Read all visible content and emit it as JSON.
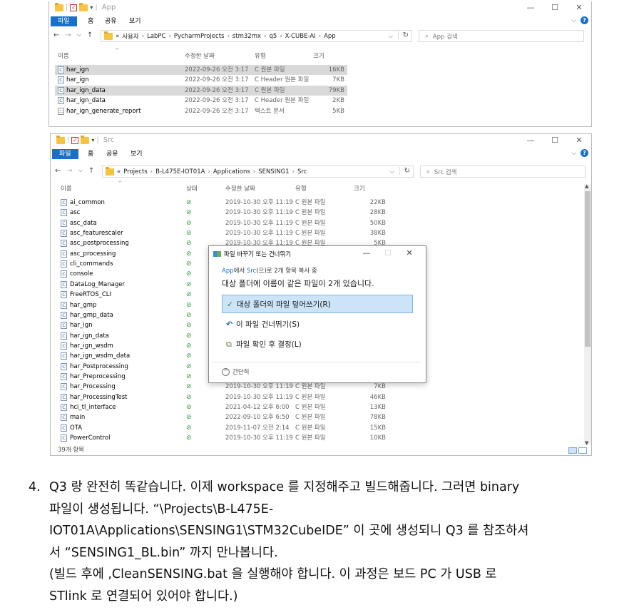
{
  "win1": {
    "title": "App",
    "ribbon": {
      "file": "파일",
      "home": "홈",
      "share": "공유",
      "view": "보기"
    },
    "address": {
      "prefix": "«",
      "parts": [
        "사용자",
        "LabPC",
        "PycharmProjects",
        "stm32mx",
        "q5",
        "X-CUBE-AI",
        "App"
      ]
    },
    "search_placeholder": "App 검색",
    "columns": {
      "name": "이름",
      "date": "수정한 날짜",
      "type": "유형",
      "size": "크기"
    },
    "files": [
      {
        "name": "har_ign",
        "date": "2022-09-26 오전 3:17",
        "type": "C 원본 파일",
        "size": "16KB",
        "icon": "C"
      },
      {
        "name": "har_ign",
        "date": "2022-09-26 오전 3:17",
        "type": "C Header 원본 파일",
        "size": "7KB",
        "icon": "C"
      },
      {
        "name": "har_ign_data",
        "date": "2022-09-26 오전 3:17",
        "type": "C 원본 파일",
        "size": "79KB",
        "icon": "C"
      },
      {
        "name": "har_ign_data",
        "date": "2022-09-26 오전 3:17",
        "type": "C Header 원본 파일",
        "size": "2KB",
        "icon": "C"
      },
      {
        "name": "har_ign_generate_report",
        "date": "2022-09-26 오전 3:17",
        "type": "텍스트 문서",
        "size": "5KB",
        "icon": "txt"
      }
    ]
  },
  "win2": {
    "title": "Src",
    "ribbon": {
      "file": "파일",
      "home": "홈",
      "share": "공유",
      "view": "보기"
    },
    "address": {
      "prefix": "«",
      "parts": [
        "Projects",
        "B-L475E-IOT01A",
        "Applications",
        "SENSING1",
        "Src"
      ]
    },
    "search_placeholder": "Src 검색",
    "columns": {
      "name": "이름",
      "status": "상태",
      "date": "수정한 날짜",
      "type": "유형",
      "size": "크기"
    },
    "files": [
      {
        "name": "ai_common",
        "date": "2019-10-30 오후 11:19",
        "type": "C 원본 파일",
        "size": "22KB"
      },
      {
        "name": "asc",
        "date": "2019-10-30 오후 11:19",
        "type": "C 원본 파일",
        "size": "28KB"
      },
      {
        "name": "asc_data",
        "date": "2019-10-30 오후 11:19",
        "type": "C 원본 파일",
        "size": "50KB"
      },
      {
        "name": "asc_featurescaler",
        "date": "2019-10-30 오후 11:19",
        "type": "C 원본 파일",
        "size": "38KB"
      },
      {
        "name": "asc_postprocessing",
        "date": "2019-10-30 오후 11:19",
        "type": "C 원본 파일",
        "size": "5KB"
      },
      {
        "name": "asc_processing",
        "date": "",
        "type": "",
        "size": ""
      },
      {
        "name": "cli_commands",
        "date": "",
        "type": "",
        "size": ""
      },
      {
        "name": "console",
        "date": "",
        "type": "",
        "size": ""
      },
      {
        "name": "DataLog_Manager",
        "date": "",
        "type": "",
        "size": ""
      },
      {
        "name": "FreeRTOS_CLI",
        "date": "",
        "type": "",
        "size": ""
      },
      {
        "name": "har_gmp",
        "date": "",
        "type": "",
        "size": ""
      },
      {
        "name": "har_gmp_data",
        "date": "",
        "type": "",
        "size": ""
      },
      {
        "name": "har_ign",
        "date": "",
        "type": "",
        "size": ""
      },
      {
        "name": "har_ign_data",
        "date": "",
        "type": "",
        "size": ""
      },
      {
        "name": "har_ign_wsdm",
        "date": "",
        "type": "",
        "size": ""
      },
      {
        "name": "har_ign_wsdm_data",
        "date": "",
        "type": "",
        "size": ""
      },
      {
        "name": "har_Postprocessing",
        "date": "",
        "type": "",
        "size": ""
      },
      {
        "name": "har_Preprocessing",
        "date": "",
        "type": "",
        "size": ""
      },
      {
        "name": "har_Processing",
        "date": "2019-10-30 오후 11:19",
        "type": "C 원본 파일",
        "size": "7KB"
      },
      {
        "name": "har_ProcessingTest",
        "date": "2019-10-30 오후 11:19",
        "type": "C 원본 파일",
        "size": "46KB"
      },
      {
        "name": "hci_tl_interface",
        "date": "2021-04-12 오후 6:00",
        "type": "C 원본 파일",
        "size": "13KB"
      },
      {
        "name": "main",
        "date": "2022-09-10 오후 6:50",
        "type": "C 원본 파일",
        "size": "78KB"
      },
      {
        "name": "OTA",
        "date": "2019-11-07 오전 2:14",
        "type": "C 원본 파일",
        "size": "15KB"
      },
      {
        "name": "PowerControl",
        "date": "2019-10-30 오후 11:19",
        "type": "C 원본 파일",
        "size": "10KB"
      }
    ],
    "status_count": "39개 항목"
  },
  "dialog": {
    "title": "파일 바꾸기 또는 건너뛰기",
    "from_src": "App",
    "from_mid": "에서 ",
    "from_dst": "Src",
    "from_tail": "(으)로 2개 항목 복사 중",
    "message": "대상 폴더에 이름이 같은 파일이 2개 있습니다.",
    "opt_replace": "대상 폴더의 파일 덮어쓰기(R)",
    "opt_skip": "이 파일 건너뛰기(S)",
    "opt_decide": "파일 확인 후 결정(L)",
    "simple": "간단히"
  },
  "instruction": {
    "number": "4.",
    "lines": [
      "Q3 랑 완전히 똑같습니다. 이제 workspace 를 지정해주고 빌드해줍니다. 그러면 binary",
      "파일이 생성됩니다. “\\Projects\\B-L475E-",
      "IOT01A\\Applications\\SENSING1\\STM32CubeIDE” 이 곳에 생성되니 Q3 를 참조하셔",
      "서 “SENSING1_BL.bin” 까지 만나봅니다.",
      "(빌드 후에 ,CleanSENSING.bat 을 실행해야 합니다. 이 과정은  보드 PC 가 USB 로",
      "STlink 로 연결되어 있어야 합니다.)"
    ]
  }
}
